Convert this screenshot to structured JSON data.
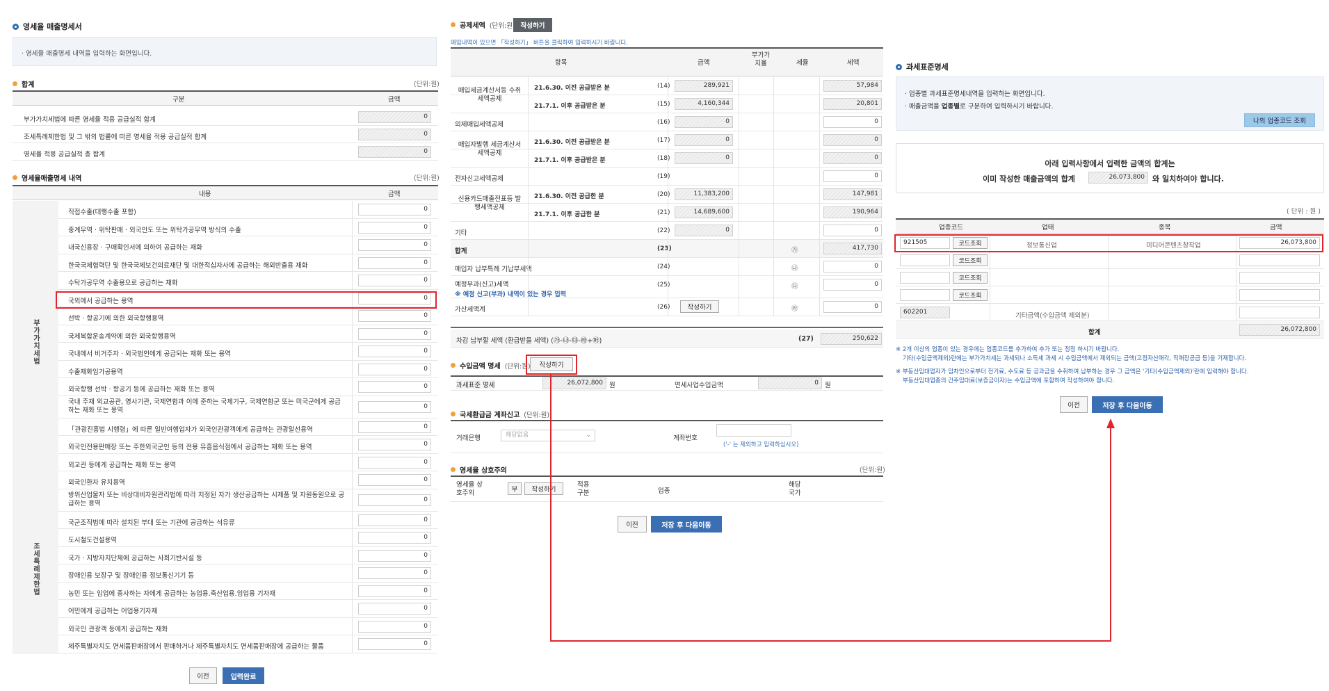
{
  "p1": {
    "title": "영세율 매출명세서",
    "info": "· 영세율 매출명세 내역을 입력하는 화면입니다.",
    "sum_title": "합계",
    "sum_unit": "(단위:원)",
    "sum_head": [
      "구분",
      "금액"
    ],
    "sum_rows": [
      {
        "label": "부가가치세법에 따른 영세율 적용 공급실적 합계",
        "value": "0"
      },
      {
        "label": "조세특례제한법 및 그 밖의 법률에 따른 영세율 적용 공급실적 합계",
        "value": "0"
      },
      {
        "label": "영세율 적용 공급실적 총 합계",
        "value": "0"
      }
    ],
    "detail_title": "영세율매출명세 내역",
    "detail_unit": "(단위:원)",
    "detail_head": [
      "내용",
      "금액"
    ],
    "side1": "부가가치세법",
    "side2": "조세특례제한법",
    "detail_rows": [
      {
        "label": "직접수출(대행수출 포함)",
        "value": "0"
      },
      {
        "label": "중계무역 · 위탁판매 · 외국인도 또는 위탁가공무역 방식의 수출",
        "value": "0"
      },
      {
        "label": "내국신용장 · 구매확인서에 의하여 공급하는 재화",
        "value": "0"
      },
      {
        "label": "한국국제협력단 및 한국국제보건의료재단 및 대한적십자사에 공급하는 해외반출용 재화",
        "value": "0"
      },
      {
        "label": "수탁가공무역 수출용으로 공급하는 재화",
        "value": "0"
      },
      {
        "label": "국외에서 공급하는 용역",
        "value": "0"
      },
      {
        "label": "선박 · 항공기에 의한 외국항행용역",
        "value": "0"
      },
      {
        "label": "국제복합운송계약에 의한 외국항행용역",
        "value": "0"
      },
      {
        "label": "국내에서 비거주자 · 외국법인에게 공급되는 재화 또는 용역",
        "value": "0"
      },
      {
        "label": "수출재화임가공용역",
        "value": "0"
      },
      {
        "label": "외국항행 선박 · 항공기 등에 공급하는 재화 또는 용역",
        "value": "0"
      },
      {
        "label": "국내 주재 외교공관, 영사기관, 국제연합과 이에 준하는 국제기구, 국제연합군 또는 미국군에게 공급하는 재화 또는 용역",
        "value": "0"
      },
      {
        "label": "「관광진흥법 시행령」에 따른 일반여행업자가 외국인관광객에게 공급하는 관광알선용역",
        "value": "0"
      },
      {
        "label": "외국인전용판매장 또는 주한외국군인 등의 전용 유흥음식점에서 공급하는 재화 또는 용역",
        "value": "0"
      },
      {
        "label": "외교관 등에게 공급하는 재화 또는 용역",
        "value": "0"
      },
      {
        "label": "외국인환자 유치용역",
        "value": "0"
      },
      {
        "label": "방위산업물자 또는 비상대비자원관리법에 따라 지정된 자가 생산공급하는 시제품 및 자원동원으로 공급하는 용역",
        "value": "0"
      },
      {
        "label": "국군조직법에 따라 설치된 부대 또는 기관에 공급하는 석유류",
        "value": "0"
      },
      {
        "label": "도시철도건설용역",
        "value": "0"
      },
      {
        "label": "국가 · 지방자치단체에 공급하는 사회기반시설 등",
        "value": "0"
      },
      {
        "label": "장애인용 보장구 및 장애인용 정보통신기기 등",
        "value": "0"
      },
      {
        "label": "농민 또는 임업에 종사하는 자에게 공급하는 농업용.축산업용.임업용 기자재",
        "value": "0"
      },
      {
        "label": "어민에게 공급하는 어업용기자재",
        "value": "0"
      },
      {
        "label": "외국인 관광객 등에게 공급하는 재화",
        "value": "0"
      },
      {
        "label": "제주특별자치도 면세품판매장에서 판매하거나 제주특별자치도 면세품판매장에 공급하는 물품",
        "value": "0"
      }
    ],
    "btn_prev": "이전",
    "btn_done": "입력완료"
  },
  "p2": {
    "deduct_title": "공제세액",
    "deduct_unit": "(단위:원)",
    "deduct_btn": "작성하기",
    "deduct_note": "매입내역이 있으면 「작성하기」 버튼을 클릭하여 입력하시기 바랍니다.",
    "head": [
      "항목",
      "금액",
      "부가가치율",
      "세율",
      "세액"
    ],
    "rows": [
      {
        "group": "매입세금계산서등 수취세액공제",
        "sub": "21.6.30. 이전 공급받은 분",
        "no": "(14)",
        "amt": "289,921",
        "tax": "57,984"
      },
      {
        "group": "",
        "sub": "21.7.1. 이후 공급받은 분",
        "no": "(15)",
        "amt": "4,160,344",
        "tax": "20,801"
      },
      {
        "group": "의제매입세액공제",
        "sub": "",
        "no": "(16)",
        "amt": "0",
        "tax": "0"
      },
      {
        "group": "매입자발행 세금계산서 세액공제",
        "sub": "21.6.30. 이전 공급받은 분",
        "no": "(17)",
        "amt": "0",
        "tax": "0"
      },
      {
        "group": "",
        "sub": "21.7.1. 이후 공급받은 분",
        "no": "(18)",
        "amt": "0",
        "tax": "0"
      },
      {
        "group": "전자신고세액공제",
        "sub": "",
        "no": "(19)",
        "amt": "",
        "tax": "0"
      },
      {
        "group": "신용카드매출전표등 발행세액공제",
        "sub": "21.6.30. 이전 공급한 분",
        "no": "(20)",
        "amt": "11,383,200",
        "tax": "147,981"
      },
      {
        "group": "",
        "sub": "21.7.1. 이후 공급한 분",
        "no": "(21)",
        "amt": "14,689,600",
        "tax": "190,964"
      },
      {
        "group": "기타",
        "sub": "",
        "no": "(22)",
        "amt": "0",
        "tax": "0"
      },
      {
        "group": "합계",
        "sub": "",
        "no": "(23)",
        "amt": "",
        "rate": "㉮",
        "tax": "417,730"
      },
      {
        "group": "매입자 납부특례 기납부세액",
        "sub": "",
        "no": "(24)",
        "amt": "",
        "rate": "㉯",
        "tax": "0"
      },
      {
        "group": "예정부과(신고)세액",
        "sub": "",
        "no": "(25)",
        "amt": "",
        "rate": "㉰",
        "tax": "0"
      },
      {
        "group": "가산세액계",
        "sub": "",
        "no": "(26)",
        "amt": "",
        "rate": "㉱",
        "tax": "0"
      }
    ],
    "prelim_note": "※ 예정 신고(부과) 내역이 있는 경우 입력",
    "write_btn": "작성하기",
    "final_label": "차감 납부할 세액 (환급받을 세액) (㉮-㉯-㉰-㉱+㉲)",
    "final_no": "(27)",
    "final_value": "250,622",
    "income_title": "수입금액 명세",
    "income_unit": "(단위:원)",
    "income_btn": "작성하기",
    "tax_std_label": "과세표준 명세",
    "tax_std_value": "26,072,800",
    "won": "원",
    "exempt_label": "면세사업수입금액",
    "exempt_value": "0",
    "refund_title": "국세환급금 계좌신고",
    "refund_unit": "(단위:원)",
    "bank_label": "거래은행",
    "bank_value": "해당없음",
    "acct_label": "계좌번호",
    "acct_note": "('-' 는 제외하고 입력하십시오)",
    "mutual_title": "영세율 상호주의",
    "mutual_unit": "(단위:원)",
    "mutual_label": "영세율 상호주의",
    "mutual_value": "부",
    "mutual_btn": "작성하기",
    "apply_label": "적용 구분",
    "biz_label": "업종",
    "country_label": "해당 국가",
    "btn_prev": "이전",
    "btn_next": "저장 후 다음이동"
  },
  "p3": {
    "title": "과세표준명세",
    "info1": "· 업종별 과세표준명세내역을 입력하는 화면입니다.",
    "info2a": "· 매출금액을 ",
    "info2b": "업종별",
    "info2c": "로 구분하여 입력하시기 바랍니다.",
    "my_code_btn": "나의 업종코드 조회",
    "match1": "아래 입력사항에서  입력한 금액의 합계는",
    "match2a": "이미 작성한 매출금액의 합계",
    "match_value": "26,073,800",
    "match2b": "와 일치하여야 합니다.",
    "unit": "( 단위 : 원 )",
    "head": [
      "업종코드",
      "업태",
      "종목",
      "금액"
    ],
    "code_btn": "코드조회",
    "row1": {
      "code": "921505",
      "type": "정보통신업",
      "item": "미디어콘텐츠창작업",
      "amount": "26,073,800"
    },
    "other_code": "602201",
    "other_label": "기타금액(수입금액 제외분)",
    "total_label": "합계",
    "total_value": "26,072,800",
    "note1": "※ 2개 이상의 업종이 있는 경우에는 업종코드를 추가하여 추가 또는 정정 하시기 바랍니다.",
    "note1b": "기타(수입금액제외)란에는 부가가치세는 과세되나 소득세 과세 시 수입금액에서 제외되는 금액(고정자산매각, 직매장공급 등)을 기재합니다.",
    "note2": "※ 부동산임대업자가 임차인으로부터 전기료, 수도료 등 공과금을 수취하여 납부하는 경우 그 금액은 '기타(수입금액제외)'란에 입력해야 합니다.",
    "note2b": "부동산임대업종의 간주임대료(보증금이자)는 수입금액에 포함하여 작성하여야 합니다.",
    "btn_prev": "이전",
    "btn_next": "저장 후 다음이동"
  },
  "colors": {
    "accent": "#3a6fb4",
    "highlight": "#e0262c",
    "orange": "#f2a03d"
  }
}
